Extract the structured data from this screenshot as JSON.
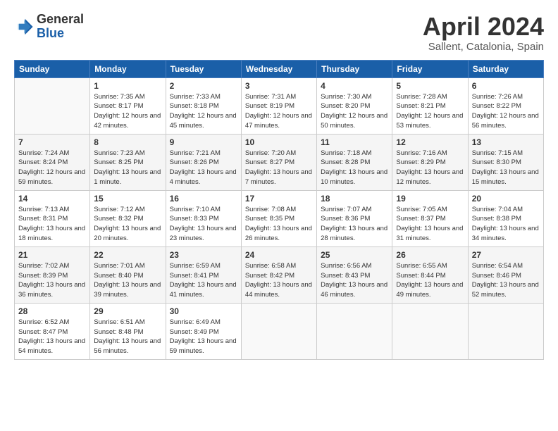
{
  "header": {
    "logo_general": "General",
    "logo_blue": "Blue",
    "title": "April 2024",
    "location": "Sallent, Catalonia, Spain"
  },
  "weekdays": [
    "Sunday",
    "Monday",
    "Tuesday",
    "Wednesday",
    "Thursday",
    "Friday",
    "Saturday"
  ],
  "weeks": [
    [
      {
        "day": "",
        "sunrise": "",
        "sunset": "",
        "daylight": ""
      },
      {
        "day": "1",
        "sunrise": "Sunrise: 7:35 AM",
        "sunset": "Sunset: 8:17 PM",
        "daylight": "Daylight: 12 hours and 42 minutes."
      },
      {
        "day": "2",
        "sunrise": "Sunrise: 7:33 AM",
        "sunset": "Sunset: 8:18 PM",
        "daylight": "Daylight: 12 hours and 45 minutes."
      },
      {
        "day": "3",
        "sunrise": "Sunrise: 7:31 AM",
        "sunset": "Sunset: 8:19 PM",
        "daylight": "Daylight: 12 hours and 47 minutes."
      },
      {
        "day": "4",
        "sunrise": "Sunrise: 7:30 AM",
        "sunset": "Sunset: 8:20 PM",
        "daylight": "Daylight: 12 hours and 50 minutes."
      },
      {
        "day": "5",
        "sunrise": "Sunrise: 7:28 AM",
        "sunset": "Sunset: 8:21 PM",
        "daylight": "Daylight: 12 hours and 53 minutes."
      },
      {
        "day": "6",
        "sunrise": "Sunrise: 7:26 AM",
        "sunset": "Sunset: 8:22 PM",
        "daylight": "Daylight: 12 hours and 56 minutes."
      }
    ],
    [
      {
        "day": "7",
        "sunrise": "Sunrise: 7:24 AM",
        "sunset": "Sunset: 8:24 PM",
        "daylight": "Daylight: 12 hours and 59 minutes."
      },
      {
        "day": "8",
        "sunrise": "Sunrise: 7:23 AM",
        "sunset": "Sunset: 8:25 PM",
        "daylight": "Daylight: 13 hours and 1 minute."
      },
      {
        "day": "9",
        "sunrise": "Sunrise: 7:21 AM",
        "sunset": "Sunset: 8:26 PM",
        "daylight": "Daylight: 13 hours and 4 minutes."
      },
      {
        "day": "10",
        "sunrise": "Sunrise: 7:20 AM",
        "sunset": "Sunset: 8:27 PM",
        "daylight": "Daylight: 13 hours and 7 minutes."
      },
      {
        "day": "11",
        "sunrise": "Sunrise: 7:18 AM",
        "sunset": "Sunset: 8:28 PM",
        "daylight": "Daylight: 13 hours and 10 minutes."
      },
      {
        "day": "12",
        "sunrise": "Sunrise: 7:16 AM",
        "sunset": "Sunset: 8:29 PM",
        "daylight": "Daylight: 13 hours and 12 minutes."
      },
      {
        "day": "13",
        "sunrise": "Sunrise: 7:15 AM",
        "sunset": "Sunset: 8:30 PM",
        "daylight": "Daylight: 13 hours and 15 minutes."
      }
    ],
    [
      {
        "day": "14",
        "sunrise": "Sunrise: 7:13 AM",
        "sunset": "Sunset: 8:31 PM",
        "daylight": "Daylight: 13 hours and 18 minutes."
      },
      {
        "day": "15",
        "sunrise": "Sunrise: 7:12 AM",
        "sunset": "Sunset: 8:32 PM",
        "daylight": "Daylight: 13 hours and 20 minutes."
      },
      {
        "day": "16",
        "sunrise": "Sunrise: 7:10 AM",
        "sunset": "Sunset: 8:33 PM",
        "daylight": "Daylight: 13 hours and 23 minutes."
      },
      {
        "day": "17",
        "sunrise": "Sunrise: 7:08 AM",
        "sunset": "Sunset: 8:35 PM",
        "daylight": "Daylight: 13 hours and 26 minutes."
      },
      {
        "day": "18",
        "sunrise": "Sunrise: 7:07 AM",
        "sunset": "Sunset: 8:36 PM",
        "daylight": "Daylight: 13 hours and 28 minutes."
      },
      {
        "day": "19",
        "sunrise": "Sunrise: 7:05 AM",
        "sunset": "Sunset: 8:37 PM",
        "daylight": "Daylight: 13 hours and 31 minutes."
      },
      {
        "day": "20",
        "sunrise": "Sunrise: 7:04 AM",
        "sunset": "Sunset: 8:38 PM",
        "daylight": "Daylight: 13 hours and 34 minutes."
      }
    ],
    [
      {
        "day": "21",
        "sunrise": "Sunrise: 7:02 AM",
        "sunset": "Sunset: 8:39 PM",
        "daylight": "Daylight: 13 hours and 36 minutes."
      },
      {
        "day": "22",
        "sunrise": "Sunrise: 7:01 AM",
        "sunset": "Sunset: 8:40 PM",
        "daylight": "Daylight: 13 hours and 39 minutes."
      },
      {
        "day": "23",
        "sunrise": "Sunrise: 6:59 AM",
        "sunset": "Sunset: 8:41 PM",
        "daylight": "Daylight: 13 hours and 41 minutes."
      },
      {
        "day": "24",
        "sunrise": "Sunrise: 6:58 AM",
        "sunset": "Sunset: 8:42 PM",
        "daylight": "Daylight: 13 hours and 44 minutes."
      },
      {
        "day": "25",
        "sunrise": "Sunrise: 6:56 AM",
        "sunset": "Sunset: 8:43 PM",
        "daylight": "Daylight: 13 hours and 46 minutes."
      },
      {
        "day": "26",
        "sunrise": "Sunrise: 6:55 AM",
        "sunset": "Sunset: 8:44 PM",
        "daylight": "Daylight: 13 hours and 49 minutes."
      },
      {
        "day": "27",
        "sunrise": "Sunrise: 6:54 AM",
        "sunset": "Sunset: 8:46 PM",
        "daylight": "Daylight: 13 hours and 52 minutes."
      }
    ],
    [
      {
        "day": "28",
        "sunrise": "Sunrise: 6:52 AM",
        "sunset": "Sunset: 8:47 PM",
        "daylight": "Daylight: 13 hours and 54 minutes."
      },
      {
        "day": "29",
        "sunrise": "Sunrise: 6:51 AM",
        "sunset": "Sunset: 8:48 PM",
        "daylight": "Daylight: 13 hours and 56 minutes."
      },
      {
        "day": "30",
        "sunrise": "Sunrise: 6:49 AM",
        "sunset": "Sunset: 8:49 PM",
        "daylight": "Daylight: 13 hours and 59 minutes."
      },
      {
        "day": "",
        "sunrise": "",
        "sunset": "",
        "daylight": ""
      },
      {
        "day": "",
        "sunrise": "",
        "sunset": "",
        "daylight": ""
      },
      {
        "day": "",
        "sunrise": "",
        "sunset": "",
        "daylight": ""
      },
      {
        "day": "",
        "sunrise": "",
        "sunset": "",
        "daylight": ""
      }
    ]
  ]
}
